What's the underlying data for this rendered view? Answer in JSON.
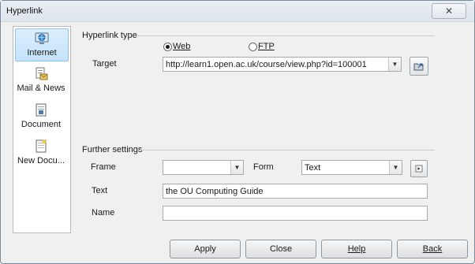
{
  "window": {
    "title": "Hyperlink",
    "close_glyph": "✕"
  },
  "sidebar": {
    "items": [
      {
        "label": "Internet",
        "icon": "globe-icon",
        "selected": true
      },
      {
        "label": "Mail & News",
        "icon": "mail-icon",
        "selected": false
      },
      {
        "label": "Document",
        "icon": "document-icon",
        "selected": false
      },
      {
        "label": "New Docu...",
        "icon": "new-document-icon",
        "selected": false
      }
    ]
  },
  "hyperlink_type": {
    "title": "Hyperlink type",
    "options": [
      {
        "label": "Web",
        "selected": true
      },
      {
        "label": "FTP",
        "selected": false
      }
    ]
  },
  "target": {
    "label": "Target",
    "value": "http://learn1.open.ac.uk/course/view.php?id=100001"
  },
  "further_settings": {
    "title": "Further settings",
    "frame": {
      "label": "Frame",
      "value": ""
    },
    "form": {
      "label": "Form",
      "value": "Text"
    },
    "text": {
      "label": "Text",
      "value": "the OU Computing Guide"
    },
    "name": {
      "label": "Name",
      "value": ""
    }
  },
  "buttons": {
    "apply": "Apply",
    "close": "Close",
    "help": "Help",
    "back": "Back"
  }
}
